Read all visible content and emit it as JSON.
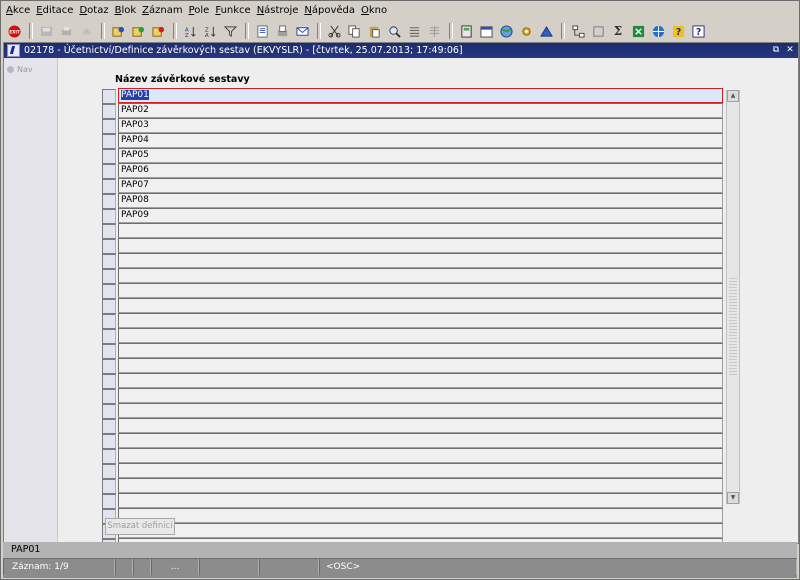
{
  "menu": [
    "Akce",
    "Editace",
    "Dotaz",
    "Blok",
    "Záznam",
    "Pole",
    "Funkce",
    "Nástroje",
    "Nápověda",
    "Okno"
  ],
  "toolbar": {
    "exit_label": "EXIT",
    "sigma_label": "Σ"
  },
  "window": {
    "title": "02178 - Účetnictví/Definice závěrkových sestav (EKVYSLR) - [čtvrtek, 25.07.2013; 17:49:06]",
    "restore_glyph": "⧉",
    "close_glyph": "✕"
  },
  "nav": {
    "label": "Nav"
  },
  "form": {
    "column_header": "Název závěrkové sestavy",
    "rows": [
      "PAP01",
      "PAP02",
      "PAP03",
      "PAP04",
      "PAP05",
      "PAP06",
      "PAP07",
      "PAP08",
      "PAP09",
      "",
      "",
      "",
      "",
      "",
      "",
      "",
      "",
      "",
      "",
      "",
      "",
      "",
      "",
      "",
      "",
      "",
      "",
      "",
      "",
      "",
      ""
    ],
    "delete_button": "Smazat definici"
  },
  "status": {
    "message": "PAP01",
    "record": "Záznam: 1/9",
    "dots": "...",
    "mode": "<OSC>"
  },
  "colors": {
    "title_bar": "#1d2c6e",
    "active_border": "#d02020",
    "selection": "#2540a8"
  }
}
